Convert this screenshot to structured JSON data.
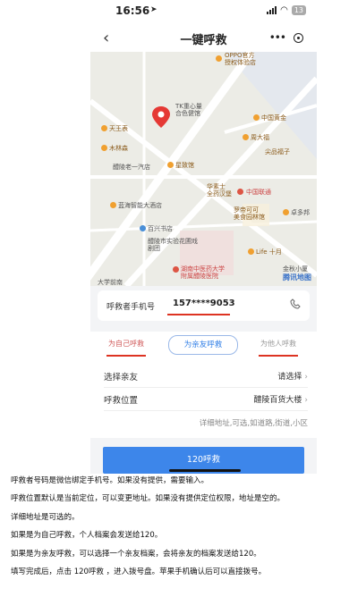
{
  "status_bar": {
    "time": "16:56",
    "battery": "13"
  },
  "nav": {
    "back_icon": "‹",
    "title": "一键呼救",
    "menu_icon": "•••"
  },
  "map": {
    "labels": [
      "OPPO官方",
      "授权体验店",
      "TK重心量",
      "合色健馆",
      "天王表",
      "中国黄金",
      "木林森",
      "周大福",
      "尖品福子",
      "醴陵老一汽店",
      "星致馆",
      "华素士",
      "全药汉堡",
      "中国联通",
      "蓝海智能大酒店",
      "罗帝可可",
      "美食园林馆",
      "卓多邦",
      "百兴书店",
      "醴陵市实验花圃戏剧团",
      "Life 十月",
      "湖南中医药大学",
      "附属醴陵医院",
      "金秋小厦",
      "大学前南",
      "腾讯地图"
    ],
    "logo": "腾讯地图"
  },
  "caller": {
    "label": "呼救者手机号",
    "number": "157****9053"
  },
  "tabs": [
    "为自己呼救",
    "为亲友呼救",
    "为他人呼救"
  ],
  "form": {
    "choose_friend_label": "选择亲友",
    "choose_friend_value": "请选择",
    "location_label": "呼救位置",
    "location_value": "醴陵百货大楼",
    "address_placeholder": "详细地址,可选,如道路,街道,小区"
  },
  "submit_button": "120呼救",
  "notes": [
    "呼救者号码是微信绑定手机号。如果没有提供，需要输入。",
    "呼救位置默认是当前定位，可以变更地址。如果没有提供定位权限，地址是空的。",
    "详细地址是可选的。",
    "如果是为自己呼救，个人档案会发送给120。",
    "如果是为亲友呼救，可以选择一个亲友档案，会将亲友的档案发送给120。",
    "填写完成后，点击 120呼救 ，进入拨号盘。苹果手机确认后可以直接拨号。"
  ],
  "colors": {
    "accent": "#3d86ea",
    "highlight": "#d32222",
    "pin": "#e53935"
  }
}
